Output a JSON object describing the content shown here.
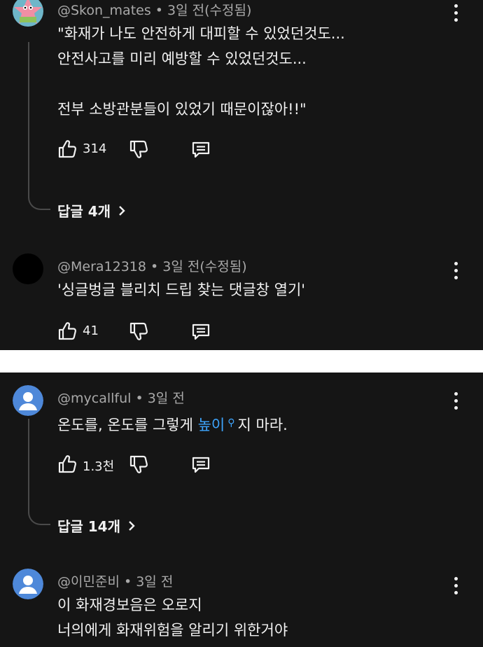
{
  "comments": [
    {
      "handle": "@Skon_mates",
      "time": "3일 전(수정됨)",
      "lines": [
        "\"화재가 나도 안전하게 대피할 수 있었던것도...",
        "안전사고를 미리 예방할 수 있었던것도...",
        "",
        "전부 소방관분들이 있었기 때문이잖아!!\""
      ],
      "likes": "314",
      "replies": "답글 4개"
    },
    {
      "handle": "@Mera12318",
      "time": "3일 전(수정됨)",
      "lines": [
        "'싱글벙글 블리치 드립 찾는 댓글창 열기'"
      ],
      "likes": "41"
    },
    {
      "handle": "@mycallful",
      "time": "3일 전",
      "text_before": "온도를, 온도를 그렇게 ",
      "text_link": "높이",
      "text_after": "지 마라.",
      "likes": "1.3천",
      "replies": "답글 14개"
    },
    {
      "handle": "@이민준비",
      "time": "3일 전",
      "lines": [
        "이 화재경보음은 오로지",
        "너의에게 화재위험을 알리기 위한거야"
      ]
    }
  ],
  "separator": " • ",
  "icons": [
    "like-icon",
    "dislike-icon",
    "reply-icon",
    "more-options-icon",
    "search-icon",
    "chevron-right-icon"
  ],
  "colors": {
    "background": "#151515",
    "text": "#f1f1f1",
    "meta": "#a9a9a9",
    "link": "#3ea6ff",
    "avatar_blue": "#4e88d9"
  }
}
